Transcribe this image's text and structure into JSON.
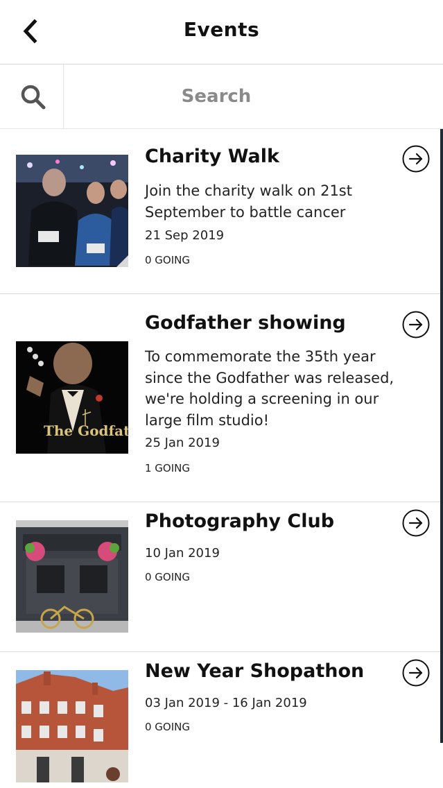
{
  "header": {
    "title": "Events",
    "back_icon": "chevron-left-icon"
  },
  "search": {
    "placeholder": "Search",
    "icon": "search-icon"
  },
  "events": [
    {
      "title": "Charity Walk",
      "description": "Join the charity walk on 21st September to battle cancer",
      "date": "21 Sep 2019",
      "going": "0 GOING",
      "thumbnail": "charity-walk-photo"
    },
    {
      "title": "Godfather showing",
      "description": "To commemorate the 35th year since the Godfather was released, we're holding a screening in our large film studio!",
      "date": "25 Jan 2019",
      "going": "1 GOING",
      "thumbnail": "godfather-poster",
      "poster_text": "The Godfather"
    },
    {
      "title": "Photography Club",
      "description": "",
      "date": "10 Jan 2019",
      "going": "0 GOING",
      "thumbnail": "pub-storefront-photo"
    },
    {
      "title": "New Year Shopathon",
      "description": "",
      "date": "03 Jan 2019 - 16 Jan 2019",
      "going": "0 GOING",
      "thumbnail": "red-brick-building-photo"
    }
  ],
  "colors": {
    "background": "#ffffff",
    "divider": "#d9d9d9",
    "placeholder": "#8a8a8a",
    "scroll_indicator": "#1d2b35"
  }
}
